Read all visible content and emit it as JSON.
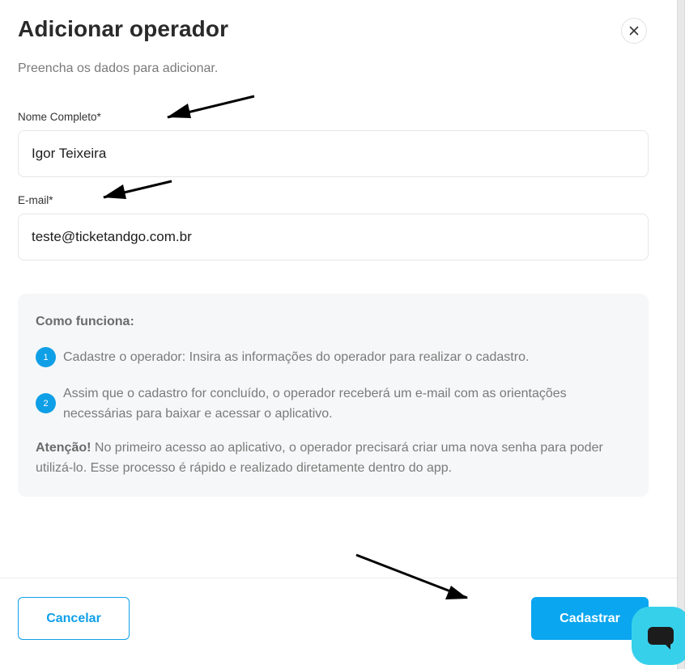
{
  "modal": {
    "title": "Adicionar operador",
    "subtitle": "Preencha os dados para adicionar.",
    "close_icon": "close-icon"
  },
  "form": {
    "name_label": "Nome Completo*",
    "name_value": "Igor Teixeira",
    "email_label": "E-mail*",
    "email_value": "teste@ticketandgo.com.br"
  },
  "info": {
    "heading": "Como funciona:",
    "steps": [
      {
        "number": "1",
        "text": "Cadastre o operador: Insira as informações do operador para realizar o cadastro."
      },
      {
        "number": "2",
        "text": "Assim que o cadastro for concluído, o operador receberá um e-mail com as orientações necessárias para baixar e acessar o aplicativo."
      }
    ],
    "attention_label": "Atenção!",
    "attention_text": " No primeiro acesso ao aplicativo, o operador precisará criar uma nova senha para poder utilizá-lo. Esse processo é rápido e realizado diretamente dentro do app."
  },
  "footer": {
    "cancel_label": "Cancelar",
    "submit_label": "Cadastrar"
  },
  "chat": {
    "icon": "chat-icon"
  },
  "colors": {
    "accent": "#0aa6f0",
    "chat": "#37d0ea",
    "panel": "#f6f7f8"
  }
}
